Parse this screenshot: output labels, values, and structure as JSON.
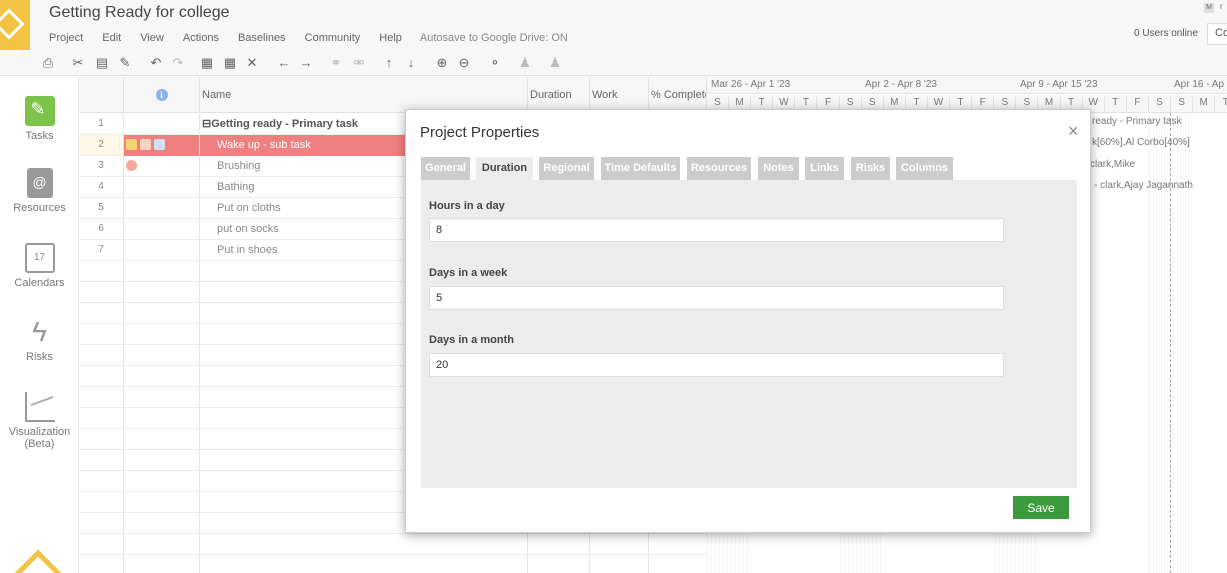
{
  "app": {
    "title": "Getting Ready for college",
    "menu": [
      "Project",
      "Edit",
      "View",
      "Actions",
      "Baselines",
      "Community",
      "Help"
    ],
    "autosave": "Autosave to Google Drive: ON",
    "users_online": "0 Users online",
    "avatar_letter": "M",
    "avatar_extra": "r",
    "co_button": "Co"
  },
  "sidebar": {
    "items": [
      {
        "label": "Tasks",
        "icon": "tasks-icon"
      },
      {
        "label": "Resources",
        "icon": "resources-icon"
      },
      {
        "label": "Calendars",
        "icon": "calendar-icon",
        "icon_text": "17"
      },
      {
        "label": "Risks",
        "icon": "lightning-icon"
      },
      {
        "label": "Visualization",
        "label2": "(Beta)",
        "icon": "chart-icon"
      }
    ]
  },
  "grid": {
    "columns": {
      "name": "Name",
      "duration": "Duration",
      "work": "Work",
      "pct": "% Complete"
    },
    "info_glyph": "i",
    "rows": [
      {
        "num": "1",
        "name": "Getting ready - Primary task",
        "parent": true
      },
      {
        "num": "2",
        "name": "Wake up - sub task",
        "selected": true
      },
      {
        "num": "3",
        "name": "Brushing"
      },
      {
        "num": "4",
        "name": "Bathing"
      },
      {
        "num": "5",
        "name": "Put on cloths"
      },
      {
        "num": "6",
        "name": "put on socks"
      },
      {
        "num": "7",
        "name": "Put in shoes"
      }
    ]
  },
  "gantt": {
    "weeks": [
      "Mar 26 - Apr 1 '23",
      "Apr 2 - Apr 8 '23",
      "Apr 9 - Apr 15 '23",
      "Apr 16 - Ap"
    ],
    "days": [
      "S",
      "M",
      "T",
      "W",
      "T",
      "F",
      "S",
      "S",
      "M",
      "T",
      "W",
      "T",
      "F",
      "S",
      "S",
      "M",
      "T",
      "W",
      "T",
      "F",
      "S",
      "S",
      "M",
      "T"
    ],
    "labels": [
      "ready - Primary task",
      "k[60%],Al Corbo[40%]",
      "clark,Mike",
      "- clark,Ajay Jagannath"
    ]
  },
  "dialog": {
    "title": "Project Properties",
    "close": "×",
    "tabs": [
      "General",
      "Duration",
      "Regional",
      "Time Defaults",
      "Resources",
      "Notes",
      "Links",
      "Risks",
      "Columns"
    ],
    "active_tab": "Duration",
    "fields": [
      {
        "label": "Hours in a day",
        "value": "8"
      },
      {
        "label": "Days in a week",
        "value": "5"
      },
      {
        "label": "Days in a month",
        "value": "20"
      }
    ],
    "save_label": "Save"
  }
}
